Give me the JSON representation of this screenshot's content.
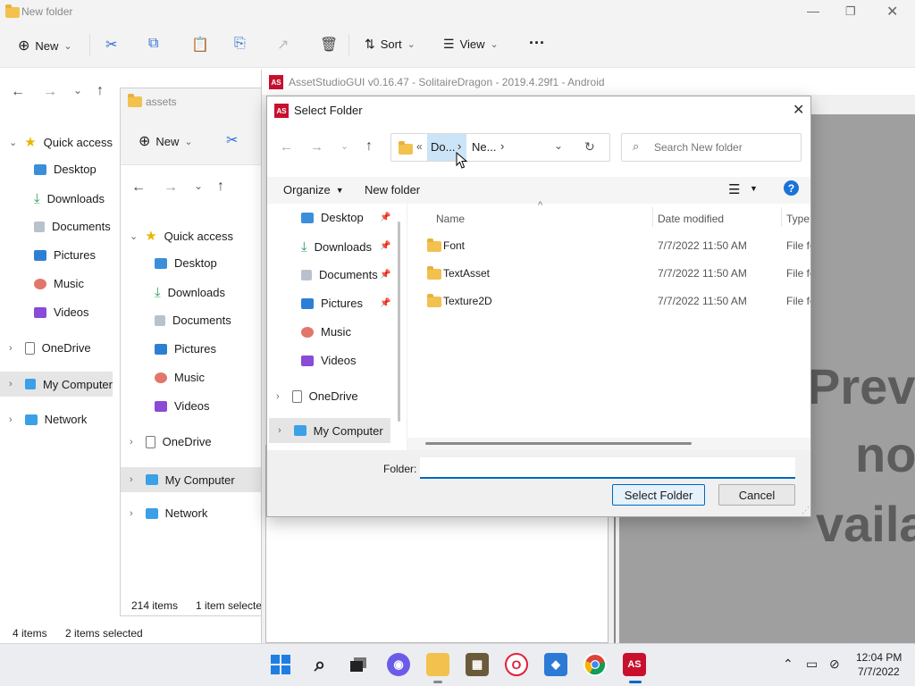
{
  "win1": {
    "title": "New folder",
    "toolbar": {
      "new": "New",
      "sort": "Sort",
      "view": "View",
      "more": "···"
    },
    "nav": {
      "quick_access": "Quick access",
      "items": [
        "Desktop",
        "Downloads",
        "Documents",
        "Pictures",
        "Music",
        "Videos"
      ],
      "onedrive": "OneDrive",
      "my_computer": "My Computer",
      "network": "Network"
    },
    "status": {
      "items": "4 items",
      "selected": "2 items selected"
    }
  },
  "win2": {
    "title": "assets",
    "toolbar": {
      "new": "New"
    },
    "nav": {
      "quick_access": "Quick access",
      "items": [
        "Desktop",
        "Downloads",
        "Documents",
        "Pictures",
        "Music",
        "Videos"
      ],
      "onedrive": "OneDrive",
      "my_computer": "My Computer",
      "network": "Network"
    },
    "status": {
      "items": "214 items",
      "selected": "1 item selecte"
    }
  },
  "assetstudio": {
    "title": "AssetStudioGUI v0.16.47 - SolitaireDragon - 2019.4.29f1 - Android",
    "preview_lines": [
      "Previ",
      "no",
      "vaila"
    ]
  },
  "dialog": {
    "title": "Select Folder",
    "breadcrumb": {
      "overflow": "«",
      "seg1": "Do...",
      "seg2": "Ne..."
    },
    "search_placeholder": "Search New folder",
    "organize": "Organize",
    "new_folder": "New folder",
    "nav": {
      "items": [
        "Desktop",
        "Downloads",
        "Documents",
        "Pictures",
        "Music",
        "Videos"
      ],
      "onedrive": "OneDrive",
      "my_computer": "My Computer"
    },
    "columns": {
      "name": "Name",
      "date": "Date modified",
      "type": "Type"
    },
    "files": [
      {
        "name": "Font",
        "date": "7/7/2022 11:50 AM",
        "type": "File fo"
      },
      {
        "name": "TextAsset",
        "date": "7/7/2022 11:50 AM",
        "type": "File fo"
      },
      {
        "name": "Texture2D",
        "date": "7/7/2022 11:50 AM",
        "type": "File fo"
      }
    ],
    "folder_label": "Folder:",
    "folder_value": "",
    "select_button": "Select Folder",
    "cancel_button": "Cancel"
  },
  "taskbar": {
    "time": "12:04 PM",
    "date": "7/7/2022",
    "app_badge": "AS"
  },
  "colors": {
    "accent": "#0067c0",
    "folder": "#f2c14e",
    "preview_bg": "#9f9f9f"
  }
}
